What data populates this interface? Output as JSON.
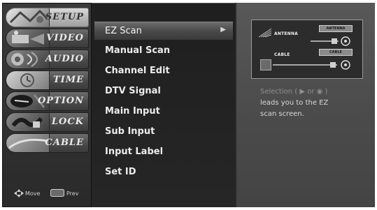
{
  "sidebar": {
    "items": [
      {
        "label": "SETUP",
        "icon": "setup-icon",
        "active": true
      },
      {
        "label": "VIDEO",
        "icon": "video-icon",
        "active": false
      },
      {
        "label": "AUDIO",
        "icon": "audio-icon",
        "active": false
      },
      {
        "label": "TIME",
        "icon": "time-icon",
        "active": false
      },
      {
        "label": "OPTION",
        "icon": "option-icon",
        "active": false
      },
      {
        "label": "LOCK",
        "icon": "lock-icon",
        "active": false
      },
      {
        "label": "CABLE",
        "icon": "cable-icon",
        "active": false
      }
    ],
    "footer": {
      "move_label": "Move",
      "prev_label": "Prev"
    }
  },
  "submenu": {
    "items": [
      {
        "label": "EZ Scan",
        "selected": true,
        "arrow": "▶"
      },
      {
        "label": "Manual Scan"
      },
      {
        "label": "Channel Edit"
      },
      {
        "label": "DTV Signal"
      },
      {
        "label": "Main Input"
      },
      {
        "label": "Sub Input"
      },
      {
        "label": "Input Label"
      },
      {
        "label": "Set ID"
      }
    ]
  },
  "help": {
    "diagram": {
      "antenna_label": "ANTENNA",
      "antenna_port": "ANTENNA",
      "cable_label": "CABLE",
      "cable_port": "CABLE"
    },
    "text_lines": [
      "Selection ( ▶ or ◉ )",
      "leads you to the EZ",
      "scan screen."
    ]
  },
  "colors": {
    "menu_bg": "#2a2a2a",
    "submenu_bg": "#222222",
    "help_bg": "#4e4e4e",
    "text_light": "#ececec"
  }
}
